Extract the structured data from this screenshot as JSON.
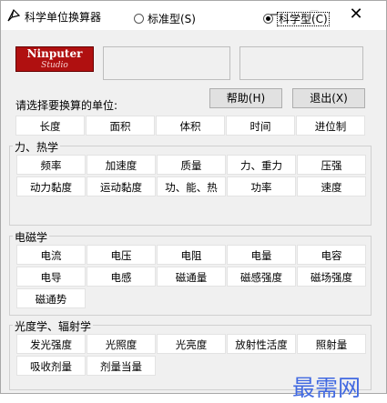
{
  "window": {
    "title": "科学单位换算器",
    "minimize": "—",
    "maximize": "☐",
    "close": "✕"
  },
  "logo": {
    "main": "Ninputer",
    "sub": "Studio"
  },
  "mode": {
    "standard_label": "标准型(S)",
    "scientific_label": "科学型(C)",
    "selected": "scientific"
  },
  "prompt": "请选择要换算的单位:",
  "buttons": {
    "help": "帮助(H)",
    "exit": "退出(X)"
  },
  "tabs": [
    "长度",
    "面积",
    "体积",
    "时间",
    "进位制"
  ],
  "groups": [
    {
      "label": "力、热学",
      "rows": [
        [
          "频率",
          "加速度",
          "质量",
          "力、重力",
          "压强"
        ],
        [
          "动力黏度",
          "运动黏度",
          "功、能、热",
          "功率",
          "速度"
        ]
      ]
    },
    {
      "label": "电磁学",
      "rows": [
        [
          "电流",
          "电压",
          "电阻",
          "电量",
          "电容"
        ],
        [
          "电导",
          "电感",
          "磁通量",
          "磁感强度",
          "磁场强度"
        ],
        [
          "磁通势"
        ]
      ]
    },
    {
      "label": "光度学、辐射学",
      "rows": [
        [
          "发光强度",
          "光照度",
          "光亮度",
          "放射性活度",
          "照射量"
        ],
        [
          "吸收剂量",
          "剂量当量"
        ]
      ]
    }
  ],
  "watermark": "最需网"
}
